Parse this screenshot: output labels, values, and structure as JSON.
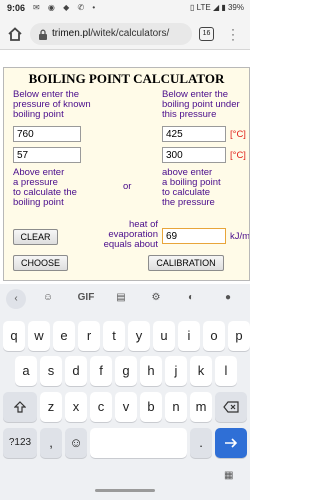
{
  "status_bar": {
    "time": "9:06",
    "battery": "39%",
    "network": "LTE"
  },
  "browser": {
    "url_host": "trimen.pl",
    "url_path": "/witek/calculators/",
    "tab_count": "16"
  },
  "calculator": {
    "title": "BOILING POINT CALCULATOR",
    "left_instruction": [
      "Below enter the",
      "pressure of known",
      "boiling point"
    ],
    "right_instruction": [
      "Below enter the",
      "boiling point under",
      "this pressure"
    ],
    "known_pressure": "760",
    "known_boiling_point": "425",
    "pressure_input": "57",
    "boiling_point_input": "300",
    "unit_celsius": "[°C]",
    "left_hint": [
      "Above enter",
      "a pressure",
      "to calculate the",
      "boiling point"
    ],
    "or_label": "or",
    "right_hint": [
      "above enter",
      "a boiling point",
      "to calculate",
      "the pressure"
    ],
    "heat_label": [
      "heat of",
      "evaporation",
      "equals about"
    ],
    "heat_value": "69",
    "heat_unit": "kJ/mol",
    "clear_label": "CLEAR",
    "choose_label": "CHOOSE",
    "calibration_label": "CALIBRATION"
  },
  "keyboard": {
    "suggestion_icons": [
      "chevron-left-icon",
      "emoji-icon",
      "GIF",
      "clipboard-icon",
      "gear-icon",
      "palette-icon",
      "mic-icon"
    ],
    "gif_label": "GIF",
    "row1": [
      "q",
      "w",
      "e",
      "r",
      "t",
      "y",
      "u",
      "i",
      "o",
      "p"
    ],
    "row2": [
      "a",
      "s",
      "d",
      "f",
      "g",
      "h",
      "j",
      "k",
      "l"
    ],
    "row3": [
      "z",
      "x",
      "c",
      "v",
      "b",
      "n",
      "m"
    ],
    "numbers_label": "?123",
    "comma_label": ",",
    "period_label": "."
  }
}
